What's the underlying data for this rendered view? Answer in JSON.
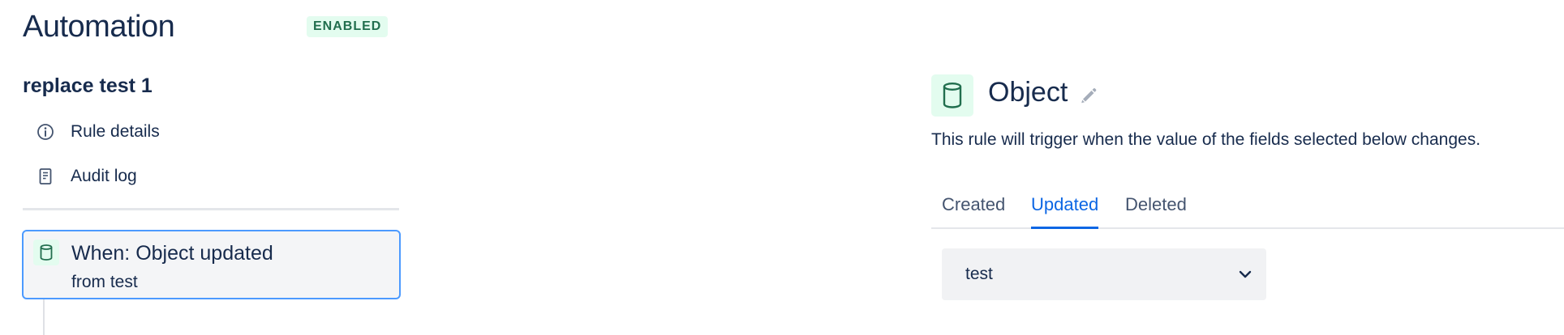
{
  "header": {
    "title": "Automation",
    "status": "ENABLED"
  },
  "sidebar": {
    "rule_name": "replace test 1",
    "items": [
      {
        "label": "Rule details",
        "icon": "info-icon"
      },
      {
        "label": "Audit log",
        "icon": "document-icon"
      }
    ],
    "trigger": {
      "title": "When: Object updated",
      "subtitle": "from test",
      "icon": "database-icon"
    }
  },
  "panel": {
    "title": "Object",
    "icon": "database-icon",
    "edit_icon": "pencil-icon",
    "description": "This rule will trigger when the value of the fields selected below changes.",
    "tabs": [
      {
        "label": "Created",
        "active": false
      },
      {
        "label": "Updated",
        "active": true
      },
      {
        "label": "Deleted",
        "active": false
      }
    ],
    "field_select": {
      "value": "test",
      "icon": "chevron-down-icon"
    }
  },
  "colors": {
    "text": "#172b4d",
    "accent": "#0c66e4",
    "success_bg": "#e3fcef",
    "success_text": "#216e4e",
    "focus_border": "#4c9aff"
  }
}
